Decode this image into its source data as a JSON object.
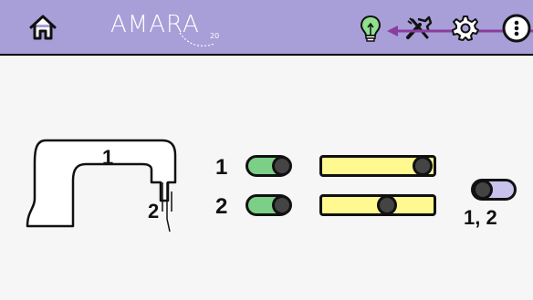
{
  "header": {
    "brand": "AMARA",
    "brand_suffix": "20",
    "background": "#a89fd8",
    "icons": [
      "home-icon",
      "lightbulb-icon",
      "tools-icon",
      "gear-icon",
      "more-icon"
    ],
    "annotation": "arrow pointing to lightbulb-icon"
  },
  "machine": {
    "head_label": "1",
    "needle_label": "2"
  },
  "channels": [
    {
      "label": "1",
      "toggle_on": true,
      "toggle_color": "#7ccf86",
      "slider_value": 0.88,
      "slider_color": "#fff98f"
    },
    {
      "label": "2",
      "toggle_on": true,
      "toggle_color": "#7ccf86",
      "slider_value": 0.55,
      "slider_color": "#fff98f"
    }
  ],
  "combined": {
    "label": "1, 2",
    "toggle_on": false,
    "toggle_color": "#c7c3ee"
  }
}
